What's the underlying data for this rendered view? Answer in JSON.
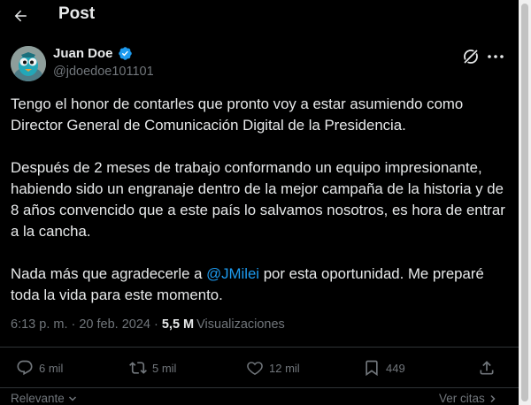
{
  "header": {
    "title": "Post"
  },
  "author": {
    "name": "Juan Doe",
    "handle": "@jdoedoe101101"
  },
  "post": {
    "p1": "Tengo el honor de contarles que pronto voy a estar asumiendo como Director General de Comunicación Digital de la Presidencia.",
    "p2": "Después de 2 meses de trabajo conformando un equipo impresionante, habiendo sido un engranaje dentro de la mejor campaña de la historia y de 8 años convencido que a este país lo salvamos nosotros, es hora de entrar a la cancha.",
    "p3_before": "Nada más que agradecerle a ",
    "p3_mention": "@JMilei",
    "p3_after": " por esta oportunidad. Me preparé toda la vida para este momento."
  },
  "meta": {
    "time": "6:13 p. m. · 20 feb. 2024 ·",
    "views_count": "5,5 M",
    "views_label": "Visualizaciones"
  },
  "actions": {
    "replies": "6 mil",
    "reposts": "5 mil",
    "likes": "12 mil",
    "bookmarks": "449"
  },
  "footer": {
    "sort": "Relevante",
    "quotes": "Ver citas"
  },
  "colors": {
    "background": "#000000",
    "text": "#e7e9ea",
    "muted": "#71767b",
    "accent": "#1d9bf0",
    "verified": "#1d9bf0"
  },
  "icons": [
    "back-arrow-icon",
    "verified-badge-icon",
    "grok-icon",
    "more-icon",
    "reply-icon",
    "repost-icon",
    "like-icon",
    "bookmark-icon",
    "share-icon",
    "chevron-down-icon",
    "chevron-right-icon"
  ]
}
